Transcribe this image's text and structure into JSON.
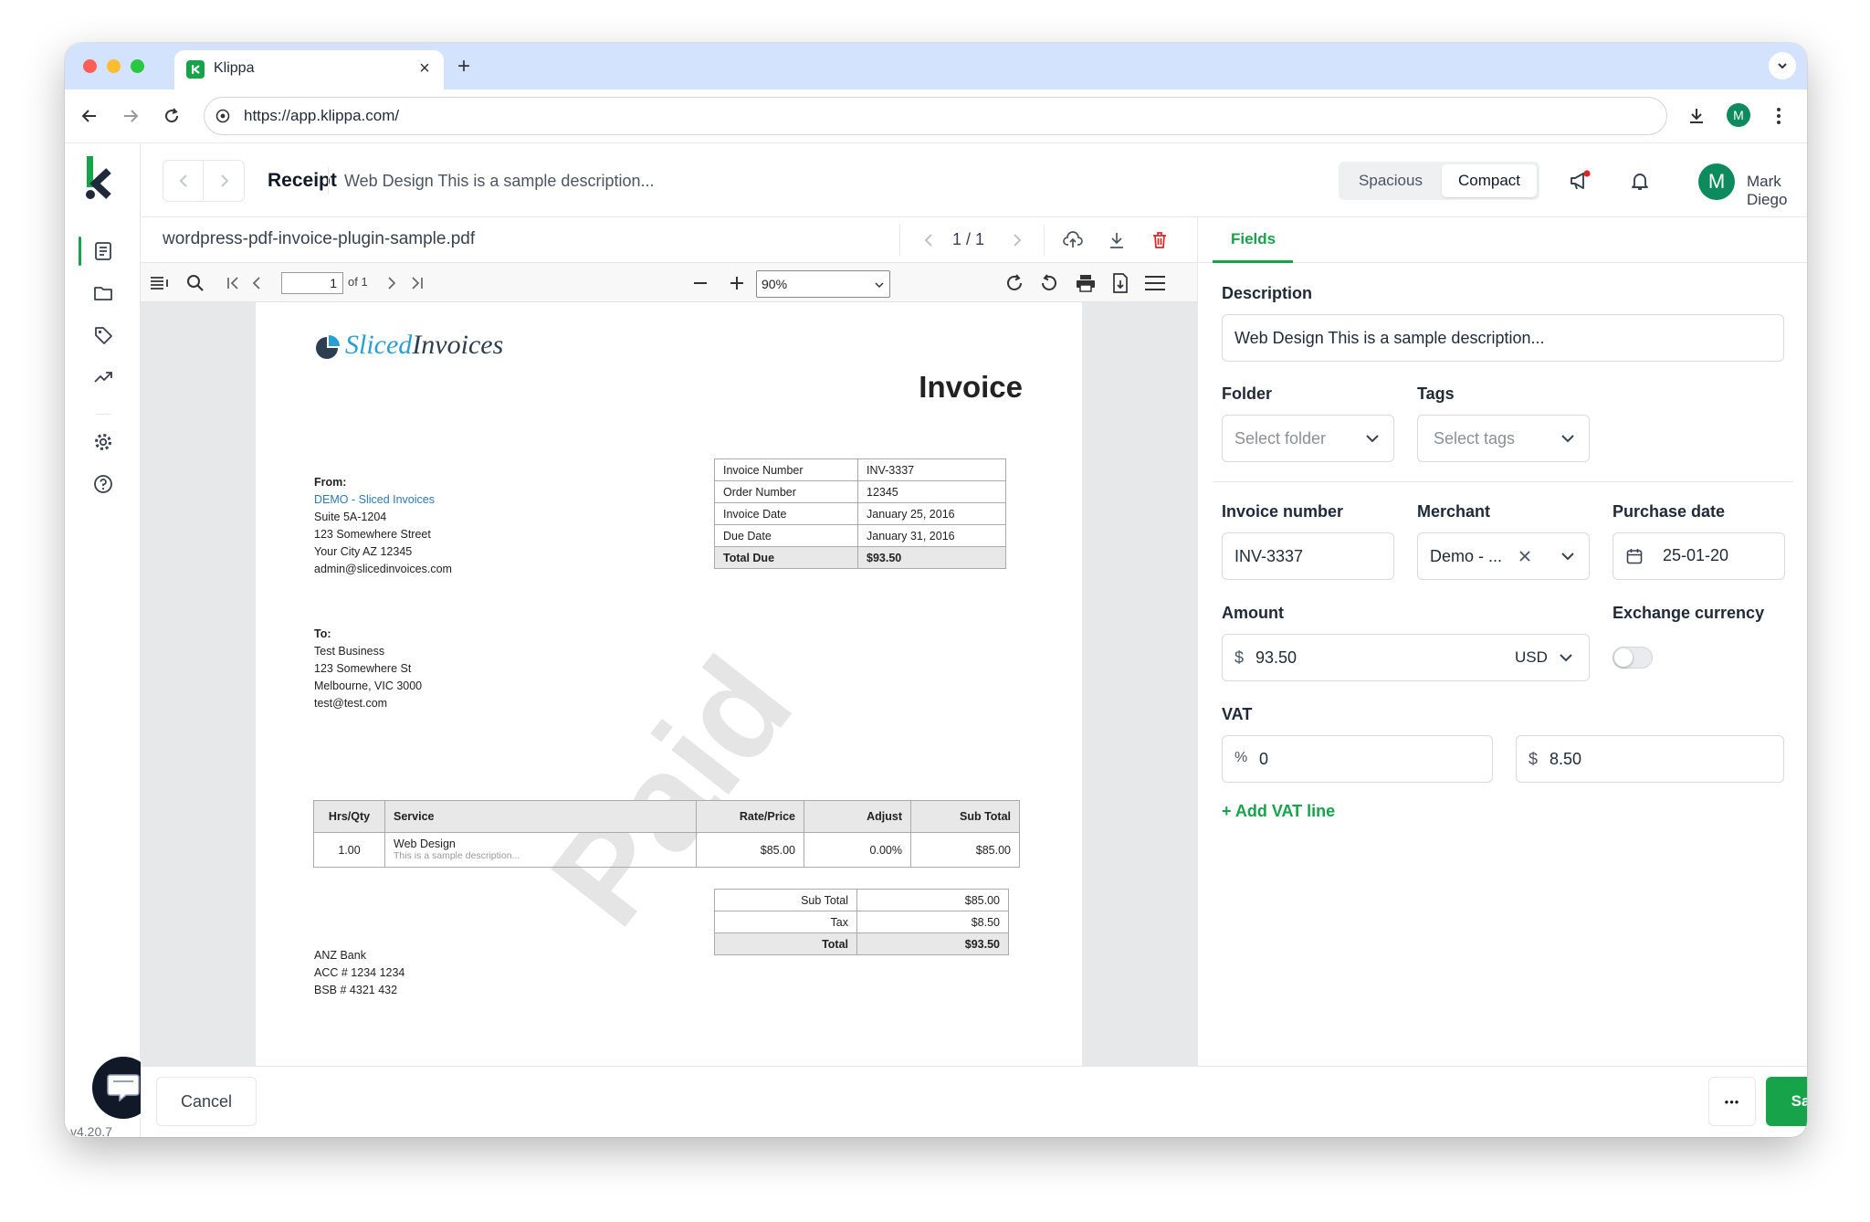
{
  "browser": {
    "tab_title": "Klippa",
    "url": "https://app.klippa.com/",
    "profile_initial": "M"
  },
  "app": {
    "doc_type": "Receipt",
    "doc_description": "Web Design This is a sample description...",
    "density_options": [
      "Spacious",
      "Compact"
    ],
    "density_selected": "Compact",
    "user_initial": "M",
    "user_name": "Mark Diego",
    "version": "v4.20.7"
  },
  "rail_icons": [
    "receipt-icon",
    "folder-icon",
    "tag-icon",
    "trend-icon",
    "settings-icon",
    "help-icon"
  ],
  "document": {
    "filename": "wordpress-pdf-invoice-plugin-sample.pdf",
    "page_indicator": "1 / 1"
  },
  "pdf_toolbar": {
    "page_value": "1",
    "page_total": "of 1",
    "zoom": "90%"
  },
  "invoice": {
    "logo_a": "Sliced",
    "logo_b": "Invoices",
    "heading": "Invoice",
    "from_label": "From:",
    "from_lines": [
      "DEMO - Sliced Invoices",
      "Suite 5A-1204",
      "123 Somewhere Street",
      "Your City AZ 12345",
      "admin@slicedinvoices.com"
    ],
    "to_label": "To:",
    "to_lines": [
      "Test Business",
      "123 Somewhere St",
      "Melbourne, VIC 3000",
      "test@test.com"
    ],
    "meta": [
      [
        "Invoice Number",
        "INV-3337"
      ],
      [
        "Order Number",
        "12345"
      ],
      [
        "Invoice Date",
        "January 25, 2016"
      ],
      [
        "Due Date",
        "January 31, 2016"
      ],
      [
        "Total Due",
        "$93.50"
      ]
    ],
    "items_headers": [
      "Hrs/Qty",
      "Service",
      "Rate/Price",
      "Adjust",
      "Sub Total"
    ],
    "item": {
      "qty": "1.00",
      "service": "Web Design",
      "desc": "This is a sample description...",
      "rate": "$85.00",
      "adjust": "0.00%",
      "subtotal": "$85.00"
    },
    "totals": [
      [
        "Sub Total",
        "$85.00"
      ],
      [
        "Tax",
        "$8.50"
      ],
      [
        "Total",
        "$93.50"
      ]
    ],
    "watermark": "Paid",
    "bank_lines": [
      "ANZ Bank",
      "ACC # 1234 1234",
      "BSB # 4321 432"
    ]
  },
  "panel": {
    "tab": "Fields",
    "description_label": "Description",
    "description_value": "Web Design This is a sample description...",
    "folder_label": "Folder",
    "folder_placeholder": "Select folder",
    "tags_label": "Tags",
    "tags_placeholder": "Select tags",
    "invoice_number_label": "Invoice number",
    "invoice_number_value": "INV-3337",
    "merchant_label": "Merchant",
    "merchant_value": "Demo - ...",
    "purchase_date_label": "Purchase date",
    "purchase_date_value": "25-01-20",
    "amount_label": "Amount",
    "amount_symbol": "$",
    "amount_value": "93.50",
    "currency": "USD",
    "exchange_label": "Exchange currency",
    "exchange_enabled": false,
    "vat_label": "VAT",
    "vat_percent_symbol": "%",
    "vat_percent_value": "0",
    "vat_amount_symbol": "$",
    "vat_amount_value": "8.50",
    "add_vat": "+ Add VAT line"
  },
  "footer": {
    "cancel": "Cancel",
    "more": "•••",
    "save": "Save"
  },
  "colors": {
    "accent": "#16a34a",
    "avatar": "#0e8a5f",
    "delete": "#dc2626",
    "link": "#2a7ab8",
    "logo_blue": "#2a9fd6"
  }
}
